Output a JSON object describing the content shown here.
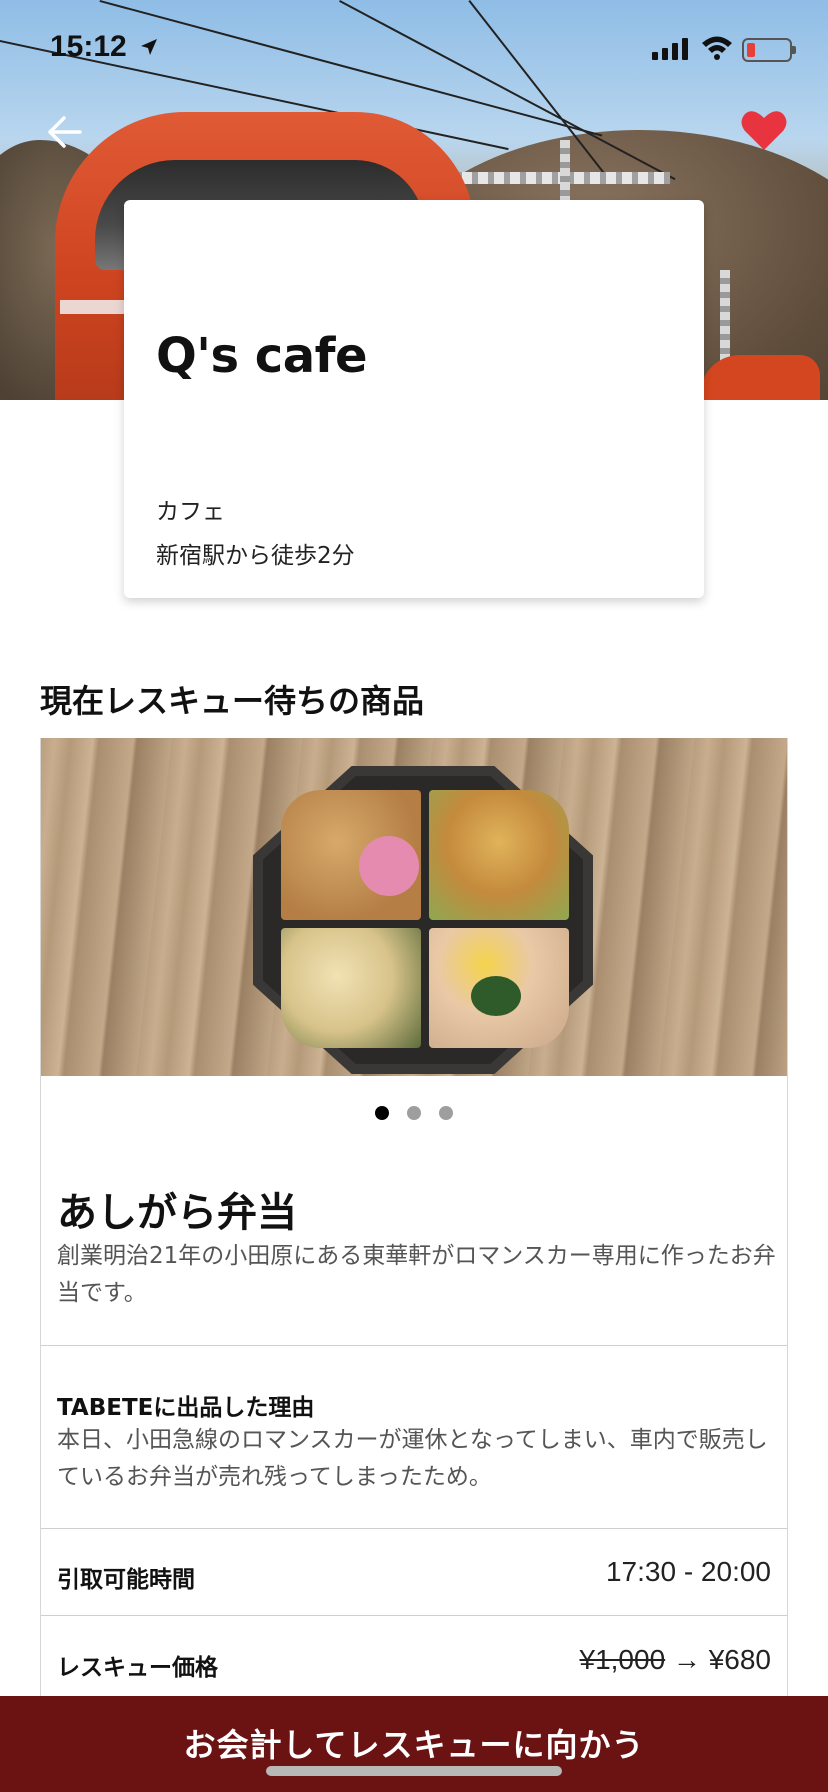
{
  "status_bar": {
    "time": "15:12",
    "icons": [
      "location-arrow-icon",
      "cellular-signal-icon",
      "wifi-icon",
      "battery-icon"
    ],
    "battery_color": "#e5403a"
  },
  "hero": {
    "image_alt": "hero train photo",
    "heart_color": "#e8343f"
  },
  "shop": {
    "name": "Q's cafe",
    "category": "カフェ",
    "access": "新宿駅から徒歩2分"
  },
  "section": {
    "title": "現在レスキュー待ちの商品"
  },
  "product": {
    "name": "あしがら弁当",
    "description": "創業明治21年の小田原にある東華軒がロマンスカー専用に作ったお弁当です。",
    "carousel": {
      "count": 3,
      "active_index": 0
    },
    "reason_title": "TABETEに出品した理由",
    "reason_text": "本日、小田急線のロマンスカーが運休となってしまい、車内で販売しているお弁当が売れ残ってしまったため。",
    "pickup_label": "引取可能時間",
    "pickup_time": "17:30 - 20:00",
    "price_label": "レスキュー価格",
    "original_price": "¥1,000",
    "arrow": "→",
    "rescue_price": "¥680"
  },
  "checkout": {
    "label": "お会計してレスキューに向かう",
    "color": "#6b1212"
  }
}
